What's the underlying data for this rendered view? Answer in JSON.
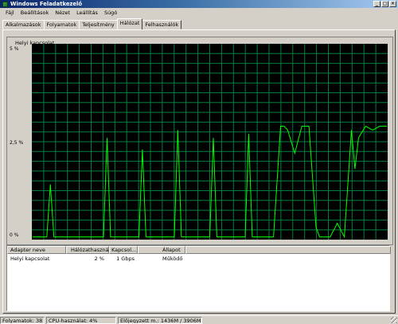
{
  "window": {
    "title": "Windows Feladatkezelő",
    "minimize": "_",
    "maximize": "□",
    "close": "✕"
  },
  "menu": [
    "Fájl",
    "Beállítások",
    "Nézet",
    "Leállítás",
    "Súgó"
  ],
  "tabs": [
    {
      "label": "Alkalmazások",
      "active": false
    },
    {
      "label": "Folyamatok",
      "active": false
    },
    {
      "label": "Teljesítmény",
      "active": false
    },
    {
      "label": "Hálózat",
      "active": true
    },
    {
      "label": "Felhasználók",
      "active": false
    }
  ],
  "network_graph": {
    "group_label": "Helyi kapcsolat",
    "y_labels": {
      "top": "5 %",
      "mid": "2,5 %",
      "bottom": "0 %"
    },
    "colors": {
      "background": "#000000",
      "grid": "#008040",
      "line": "#00ff00"
    }
  },
  "chart_data": {
    "type": "line",
    "ylim": [
      0,
      5
    ],
    "x": [
      0,
      2,
      4,
      5,
      6,
      8,
      10,
      12,
      14,
      16,
      18,
      20,
      21,
      22,
      24,
      26,
      28,
      30,
      31,
      32,
      34,
      36,
      38,
      40,
      41,
      42,
      44,
      46,
      48,
      50,
      51,
      52,
      54,
      56,
      58,
      60,
      61,
      62,
      64,
      66,
      68,
      70,
      71,
      72,
      74,
      76,
      78,
      80,
      81,
      82,
      84,
      86,
      88,
      90,
      91,
      92,
      94,
      96,
      98,
      100
    ],
    "values": [
      0.05,
      0.05,
      0.05,
      1.4,
      0.05,
      0.05,
      0.05,
      0.05,
      0.05,
      0.05,
      0.05,
      0.05,
      2.6,
      0.05,
      0.05,
      0.05,
      0.05,
      0.05,
      2.3,
      0.05,
      0.05,
      0.05,
      0.05,
      0.05,
      2.8,
      0.05,
      0.05,
      0.05,
      0.05,
      0.05,
      2.6,
      0.05,
      0.05,
      0.05,
      0.05,
      0.05,
      2.7,
      0.05,
      0.05,
      0.05,
      0.05,
      2.9,
      2.9,
      2.8,
      2.2,
      2.9,
      2.9,
      0.3,
      0.05,
      0.05,
      0.05,
      0.4,
      0.05,
      2.8,
      1.8,
      2.6,
      2.9,
      2.8,
      2.9,
      2.9
    ]
  },
  "adapter_table": {
    "headers": [
      "Adapter neve",
      "Hálózathasználat",
      "Kapcsol...",
      "Állapot"
    ],
    "rows": [
      {
        "name": "Helyi kapcsolat",
        "usage": "2 %",
        "speed": "1 Gbps",
        "status": "Működő"
      }
    ]
  },
  "status_bar": {
    "processes": "Folyamatok: 38",
    "cpu": "CPU-használat: 4%",
    "memory": "Előjegyzett m.: 1436M / 3906M"
  }
}
